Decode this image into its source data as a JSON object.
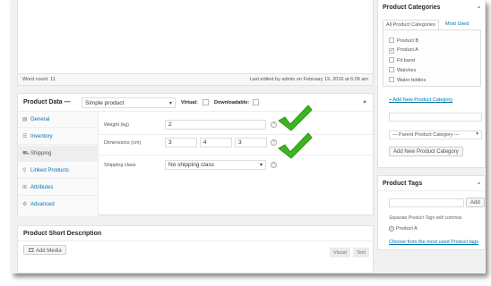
{
  "editor": {
    "word_count": "Word count: 11",
    "last_edited": "Last edited by admin on February 19, 2016 at 6:09 am"
  },
  "product_data": {
    "title": "Product Data —",
    "type_select": "Simple product",
    "virtual_label": "Virtual:",
    "downloadable_label": "Downloadable:",
    "tabs": [
      {
        "label": "General",
        "icon": "general-icon"
      },
      {
        "label": "Inventory",
        "icon": "inventory-icon"
      },
      {
        "label": "Shipping",
        "icon": "truck-icon"
      },
      {
        "label": "Linked Products",
        "icon": "link-icon"
      },
      {
        "label": "Attributes",
        "icon": "attributes-icon"
      },
      {
        "label": "Advanced",
        "icon": "gear-icon"
      }
    ],
    "active_tab": "Shipping",
    "weight_label": "Weight (kg)",
    "weight_value": "2",
    "dimensions_label": "Dimensions (cm)",
    "length_value": "3",
    "width_value": "4",
    "height_value": "3",
    "shipping_class_label": "Shipping class",
    "shipping_class_value": "No shipping class",
    "check_color": "#3cb521"
  },
  "short_description": {
    "title": "Product Short Description",
    "add_media": "Add Media",
    "visual_tab": "Visual",
    "text_tab": "Text"
  },
  "categories": {
    "title": "Product Categories",
    "tab_all": "All Product Categories",
    "tab_most_used": "Most Used",
    "items": [
      {
        "label": "Product B",
        "checked": false
      },
      {
        "label": "Product A",
        "checked": true
      },
      {
        "label": "Fit band",
        "checked": false
      },
      {
        "label": "Watches",
        "checked": false
      },
      {
        "label": "Water bottles",
        "checked": false
      }
    ],
    "add_new_link": "+ Add New Product Category",
    "parent_select": "— Parent Product Category —",
    "add_new_button": "Add New Product Category"
  },
  "tags": {
    "title": "Product Tags",
    "add_button": "Add",
    "separator_note": "Separate Product Tags with commas",
    "existing_tag": "Product A",
    "choose_link": "Choose from the most used Product tags"
  }
}
